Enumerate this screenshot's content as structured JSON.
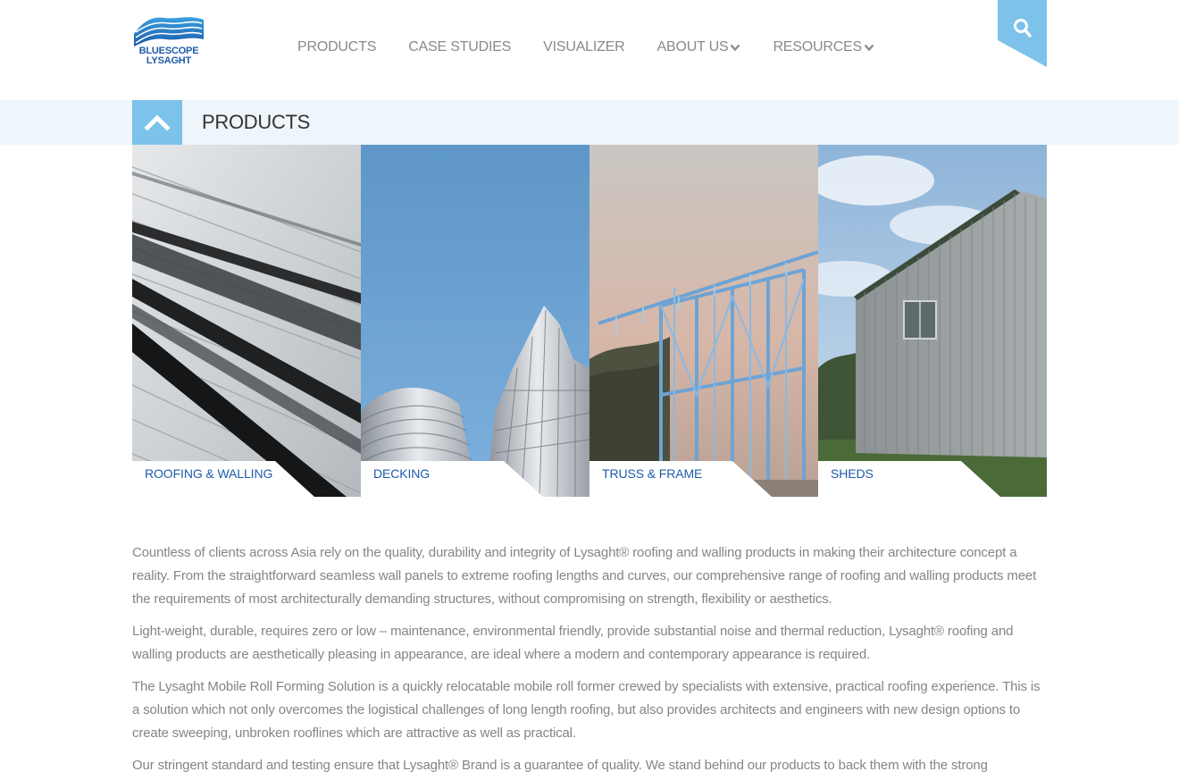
{
  "brand": {
    "name_line1": "BLUESCOPE",
    "name_line2": "LYSAGHT",
    "accent": "#7cc2ea",
    "brand_blue": "#1f5ba8"
  },
  "nav": {
    "items": [
      {
        "label": "PRODUCTS",
        "dropdown": false
      },
      {
        "label": "CASE STUDIES",
        "dropdown": false
      },
      {
        "label": "VISUALIZER",
        "dropdown": false
      },
      {
        "label": "ABOUT US",
        "dropdown": true
      },
      {
        "label": "RESOURCES",
        "dropdown": true
      }
    ],
    "search_icon": "search-icon"
  },
  "products_bar": {
    "title": "PRODUCTS",
    "toggle_icon": "chevron-up-icon"
  },
  "tiles": [
    {
      "label": "ROOFING & WALLING"
    },
    {
      "label": "DECKING"
    },
    {
      "label": "TRUSS & FRAME"
    },
    {
      "label": "SHEDS"
    }
  ],
  "content": {
    "paragraphs": [
      "Countless of clients across Asia rely on the quality, durability and integrity of Lysaght® roofing and walling products in making their architecture concept a reality. From the straightforward seamless wall panels to extreme roofing lengths and curves, our comprehensive range of roofing and walling products meet the requirements of most architecturally demanding structures, without compromising on strength, flexibility or aesthetics.",
      "Light-weight, durable, requires zero or low – maintenance, environmental friendly, provide substantial noise and thermal reduction, Lysaght® roofing and walling products are aesthetically pleasing in appearance, are ideal where a modern and contemporary appearance is required.",
      "The Lysaght Mobile Roll Forming Solution is a quickly relocatable mobile roll former crewed by specialists with extensive, practical roofing experience. This is a solution which not only overcomes the logistical challenges of long length roofing, but also provides architects and engineers with new design options to create sweeping, unbroken rooflines which are attractive as well as practical.",
      "Our stringent standard and testing ensure that Lysaght® Brand is a guarantee of quality. We stand behind our products to back them with the strong"
    ]
  }
}
